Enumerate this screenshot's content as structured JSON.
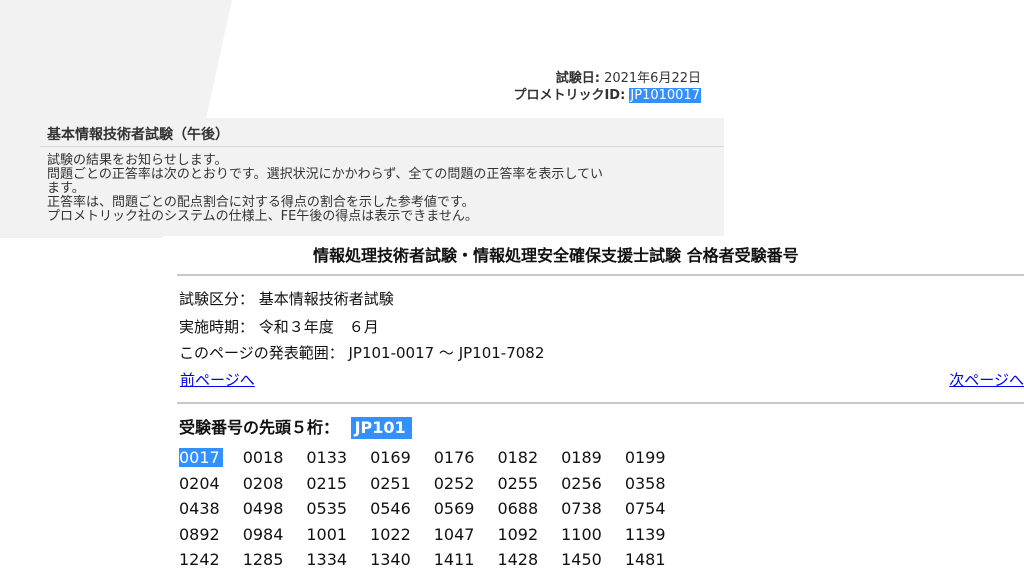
{
  "back": {
    "exam_date_label": "試験日:",
    "exam_date_value": "2021年6月22日",
    "prometric_id_label": "プロメトリックID:",
    "prometric_id_value": "JP1010017",
    "title": "基本情報技術者試験（午後）",
    "body_lines": [
      "試験の結果をお知らせします。",
      "問題ごとの正答率は次のとおりです。選択状況にかかわらず、全ての問題の正答率を表示してい",
      "ます。",
      "正答率は、問題ごとの配点割合に対する得点の割合を示した参考値です。",
      "プロメトリック社のシステムの仕様上、FE午後の得点は表示できません。"
    ]
  },
  "front": {
    "title": "情報処理技術者試験・情報処理安全確保支援士試験 合格者受験番号",
    "exam_category": "試験区分： 基本情報技術者試験",
    "exam_period": "実施時期： 令和３年度　６月",
    "range": "このページの発表範囲： JP101-0017 ～ JP101-7082",
    "prev_page": "前ページへ",
    "next_page": "次ページへ",
    "prefix_label": "受験番号の先頭５桁：",
    "prefix_value": "JP101",
    "numbers": [
      [
        "0017",
        "0018",
        "0133",
        "0169",
        "0176",
        "0182",
        "0189",
        "0199"
      ],
      [
        "0204",
        "0208",
        "0215",
        "0251",
        "0252",
        "0255",
        "0256",
        "0358"
      ],
      [
        "0438",
        "0498",
        "0535",
        "0546",
        "0569",
        "0688",
        "0738",
        "0754"
      ],
      [
        "0892",
        "0984",
        "1001",
        "1022",
        "1047",
        "1092",
        "1100",
        "1139"
      ],
      [
        "1242",
        "1285",
        "1334",
        "1340",
        "1411",
        "1428",
        "1450",
        "1481"
      ]
    ]
  },
  "colors": {
    "selection": "#3390ff",
    "link": "#0000ee",
    "backdrop": "#f2f2f2"
  }
}
